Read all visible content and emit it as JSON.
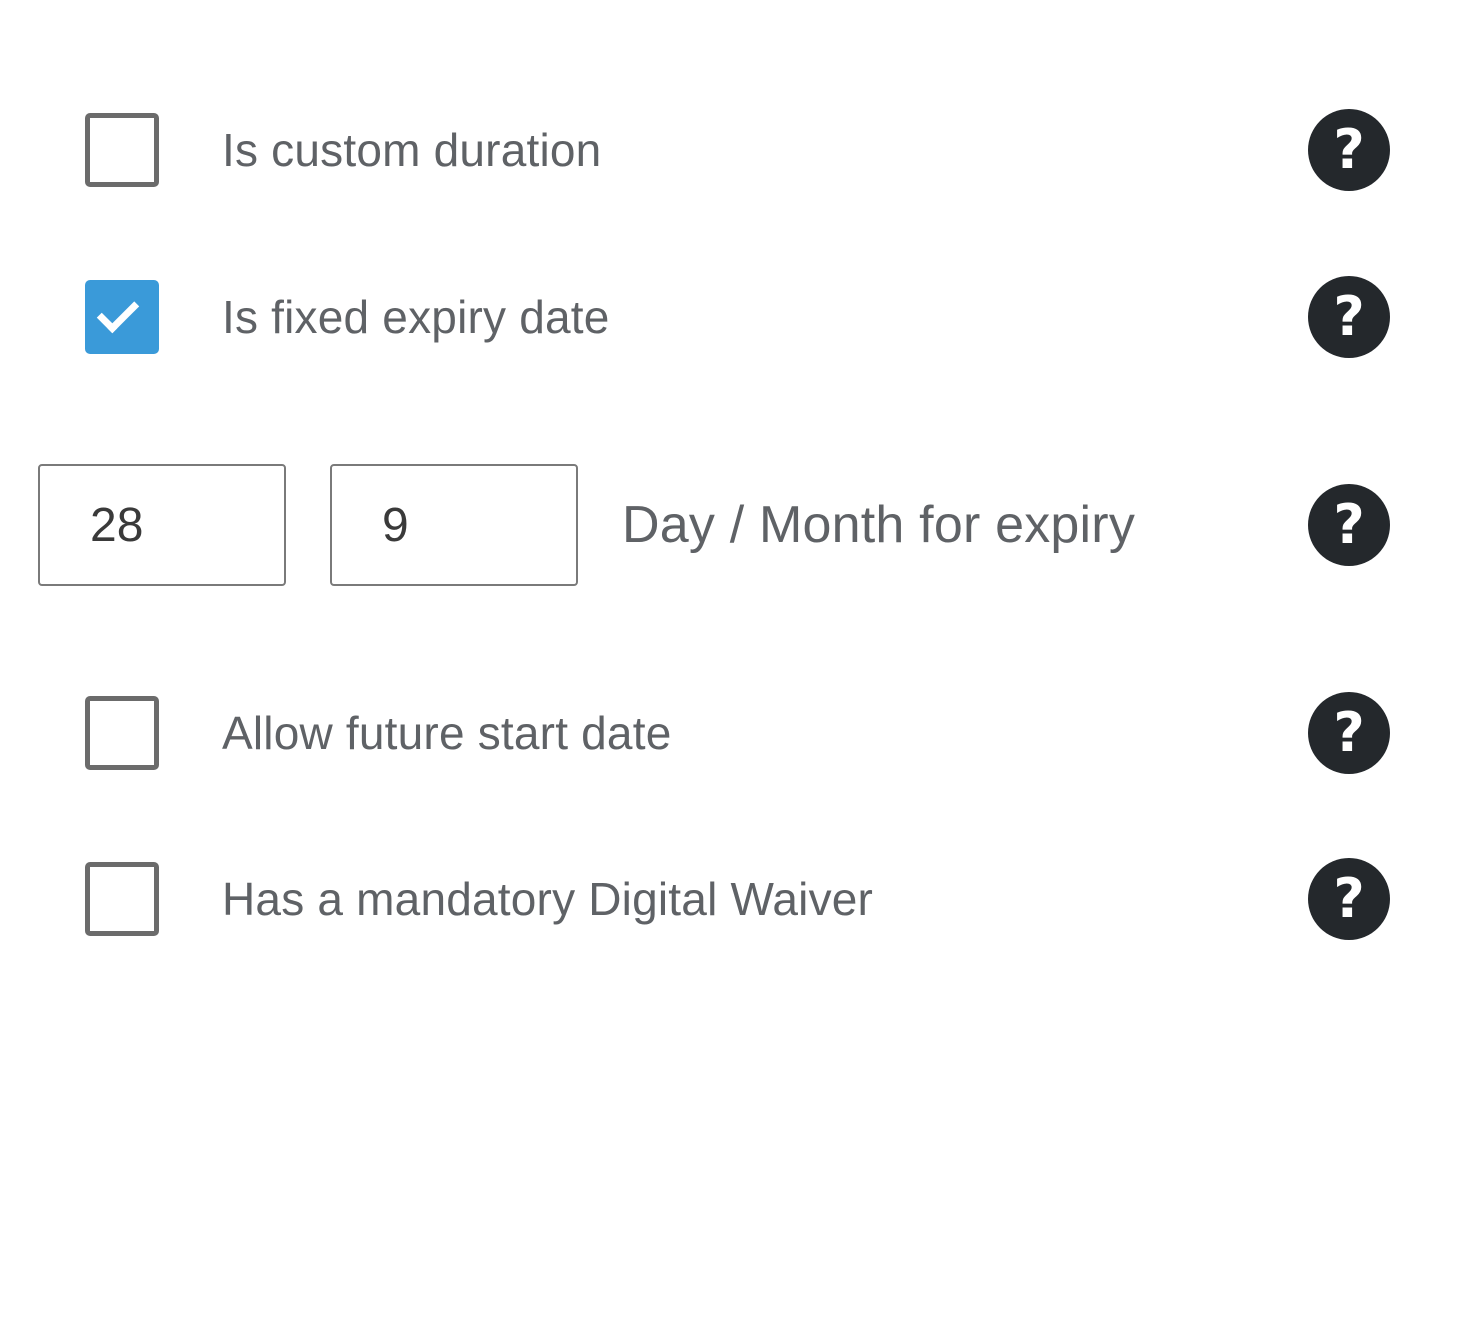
{
  "options": {
    "custom_duration": {
      "label": "Is custom duration",
      "checked": false
    },
    "fixed_expiry": {
      "label": "Is fixed expiry date",
      "checked": true
    },
    "future_start": {
      "label": "Allow future start date",
      "checked": false
    },
    "digital_waiver": {
      "label": "Has a mandatory Digital Waiver",
      "checked": false
    }
  },
  "expiry": {
    "day_value": "28",
    "month_value": "9",
    "label": "Day / Month for expiry"
  },
  "help_icon": {
    "glyph": "?",
    "icon": "question-circle-icon"
  },
  "colors": {
    "checkbox_checked": "#3a9ad9",
    "help_icon_bg": "#24282c",
    "label_text": "#5f6266"
  }
}
